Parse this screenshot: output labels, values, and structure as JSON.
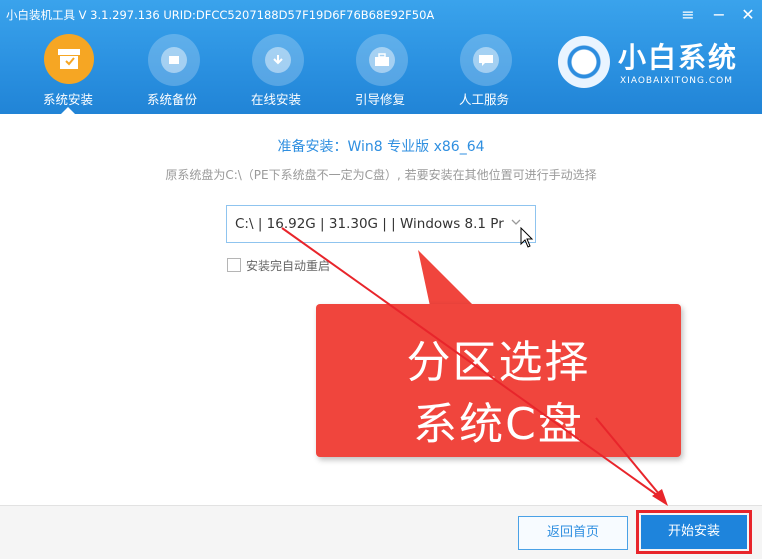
{
  "window": {
    "title": "小白装机工具 V 3.1.297.136 URID:DFCC5207188D57F19D6F76B68E92F50A",
    "menu_icon": "menu-icon",
    "minimize_icon": "minimize-icon",
    "close_icon": "close-icon"
  },
  "nav": {
    "items": [
      {
        "label": "系统安装",
        "icon": "install-box-icon",
        "active": true
      },
      {
        "label": "系统备份",
        "icon": "backup-icon"
      },
      {
        "label": "在线安装",
        "icon": "download-icon"
      },
      {
        "label": "引导修复",
        "icon": "toolbox-icon"
      },
      {
        "label": "人工服务",
        "icon": "chat-icon"
      }
    ]
  },
  "brand": {
    "name": "小白系统",
    "sub": "XIAOBAIXITONG.COM"
  },
  "main": {
    "title": "准备安装：Win8 专业版 x86_64",
    "subtitle": "原系统盘为C:\\（PE下系统盘不一定为C盘）, 若要安装在其他位置可进行手动选择",
    "partition_value": "C:\\ | 16.92G | 31.30G | | Windows 8.1 Pr",
    "auto_restart_label": "安装完自动重启"
  },
  "callout": {
    "line1": "分区选择",
    "line2": "系统C盘"
  },
  "footer": {
    "back_label": "返回首页",
    "start_label": "开始安装"
  },
  "colors": {
    "header_blue": "#2a90e0",
    "accent_orange": "#f6a623",
    "callout_red": "#f0453d",
    "highlight_red": "#e8252b",
    "primary_button": "#1e84dc"
  }
}
